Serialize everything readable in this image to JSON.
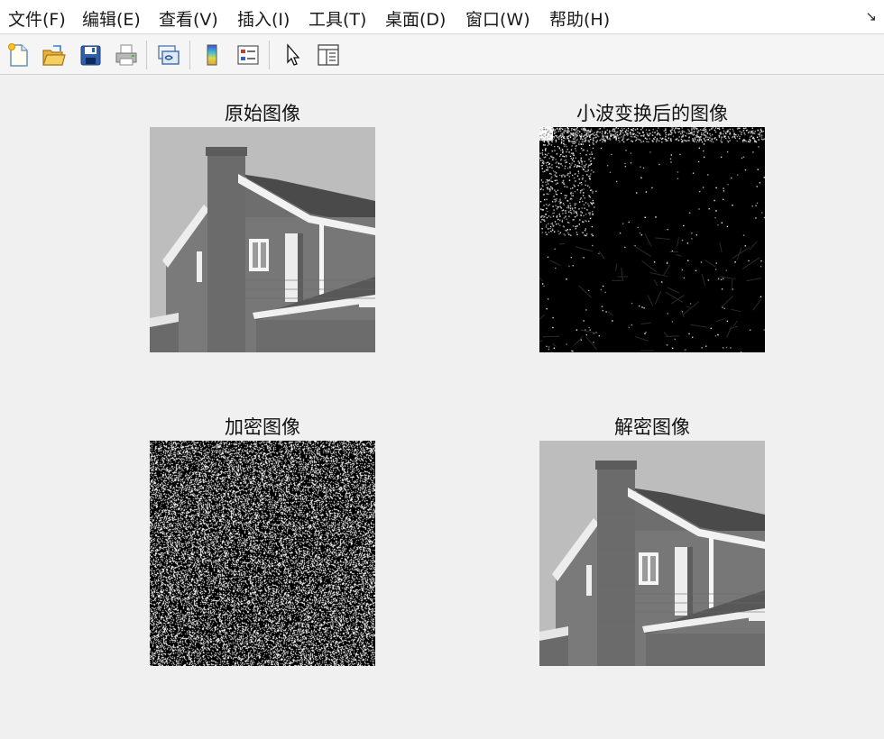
{
  "menubar": {
    "items": [
      "文件(F)",
      "编辑(E)",
      "查看(V)",
      "插入(I)",
      "工具(T)",
      "桌面(D)",
      "窗口(W)",
      "帮助(H)"
    ],
    "overflow_icon": "dock-arrow-icon"
  },
  "toolbar": {
    "buttons": [
      {
        "name": "new-figure-icon"
      },
      {
        "name": "open-file-icon"
      },
      {
        "name": "save-icon"
      },
      {
        "name": "print-icon"
      },
      {
        "name": "link-figure-icon"
      },
      {
        "name": "colorbar-icon"
      },
      {
        "name": "legend-icon"
      },
      {
        "name": "edit-plot-arrow-icon"
      },
      {
        "name": "property-inspector-icon"
      }
    ]
  },
  "panels": {
    "original": {
      "title": "原始图像"
    },
    "wavelet": {
      "title": "小波变换后的图像"
    },
    "encrypted": {
      "title": "加密图像"
    },
    "decrypted": {
      "title": "解密图像"
    }
  }
}
